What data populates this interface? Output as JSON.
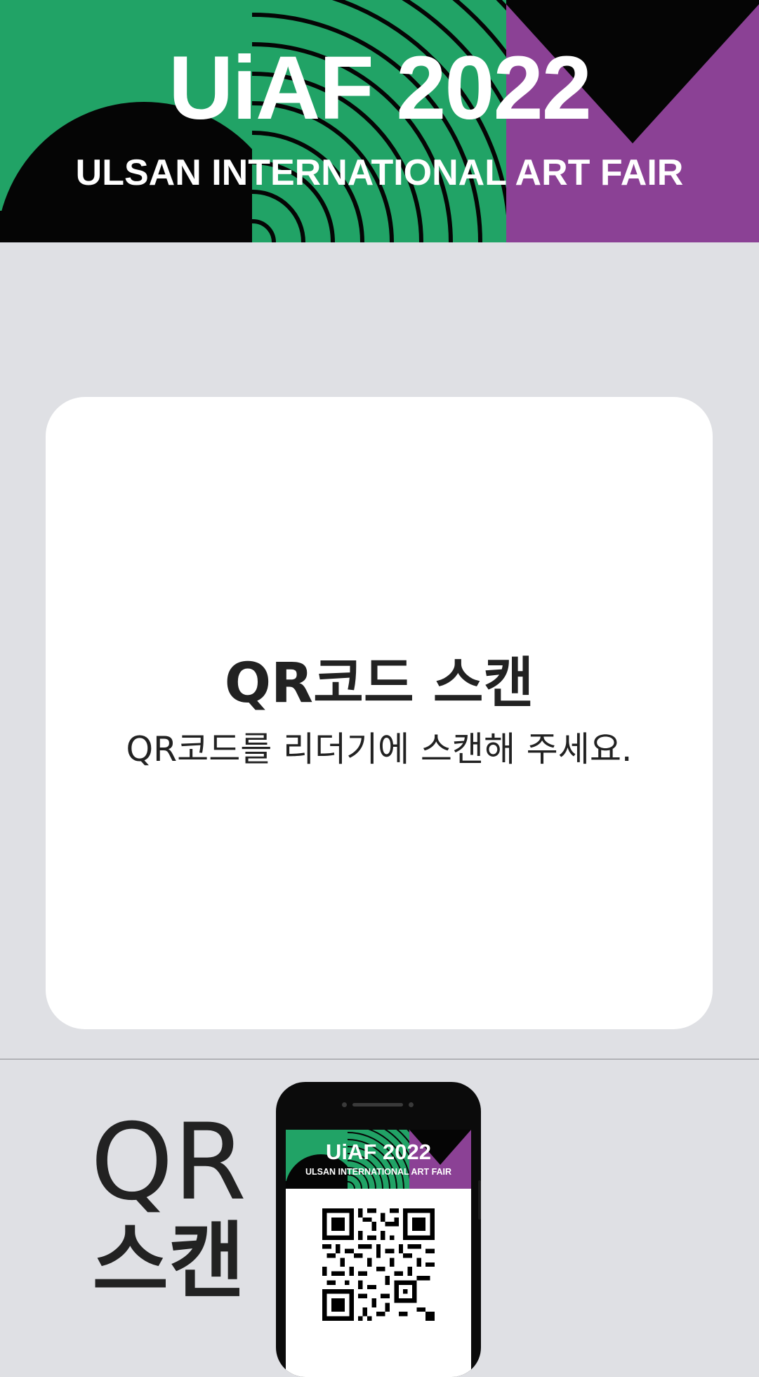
{
  "banner": {
    "title": "UiAF 2022",
    "subtitle": "ULSAN INTERNATIONAL ART FAIR",
    "colors": {
      "green": "#21a366",
      "purple": "#8b4195",
      "black": "#050505"
    }
  },
  "card": {
    "title": "QR코드 스캔",
    "subtitle": "QR코드를 리더기에 스캔해 주세요."
  },
  "guide": {
    "label_line1": "QR",
    "label_line2": "스캔",
    "phone": {
      "banner_title": "UiAF 2022",
      "banner_subtitle": "ULSAN INTERNATIONAL ART FAIR",
      "qr_icon": "qr-code-icon"
    }
  }
}
